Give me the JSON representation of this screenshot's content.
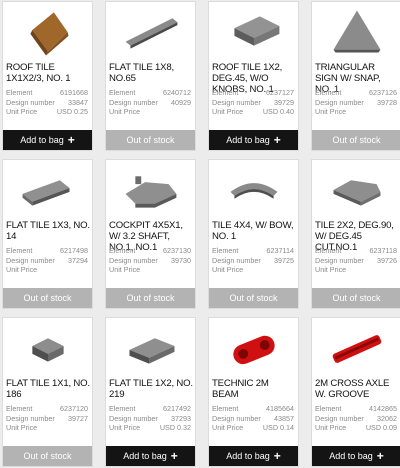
{
  "labels": {
    "element": "Element",
    "design_number": "Design number",
    "unit_price": "Unit Price",
    "add_to_bag": "Add to bag",
    "out_of_stock": "Out of stock",
    "plus": "+"
  },
  "products": [
    {
      "name": "ROOF TILE 1X1X2/3, NO. 1",
      "element": "6191668",
      "design": "33847",
      "price": "USD 0.25",
      "status": "add",
      "image": "roof-tile-brown-icon"
    },
    {
      "name": "FLAT TILE 1X8, NO.65",
      "element": "6240712",
      "design": "40929",
      "price": "",
      "status": "out",
      "image": "flat-tile-long-icon"
    },
    {
      "name": "ROOF TILE 1X2, DEG.45, W/O KNOBS, NO. 1",
      "element": "6237127",
      "design": "39729",
      "price": "USD 0.40",
      "status": "add",
      "image": "roof-tile-slope-icon"
    },
    {
      "name": "TRIANGULAR SIGN W/ SNAP, NO. 1",
      "element": "6237126",
      "design": "39728",
      "price": "",
      "status": "out",
      "image": "triangular-sign-icon"
    },
    {
      "name": "FLAT TILE 1X3, NO. 14",
      "element": "6217498",
      "design": "37294",
      "price": "",
      "status": "out",
      "image": "flat-tile-1x3-icon"
    },
    {
      "name": "COCKPIT 4X5X1, W/ 3.2 SHAFT, NO.1, NO.1",
      "element": "6237130",
      "design": "39730",
      "price": "",
      "status": "out",
      "image": "cockpit-icon"
    },
    {
      "name": "TILE 4X4, W/ BOW, NO. 1",
      "element": "6237114",
      "design": "39725",
      "price": "",
      "status": "out",
      "image": "tile-bow-icon"
    },
    {
      "name": "TILE 2X2, DEG.90, W/ DEG.45 CUT,NO.1",
      "element": "6237118",
      "design": "39726",
      "price": "",
      "status": "out",
      "image": "tile-corner-icon"
    },
    {
      "name": "FLAT TILE 1X1, NO. 186",
      "element": "6237120",
      "design": "39727",
      "price": "",
      "status": "out",
      "image": "flat-tile-1x1-icon"
    },
    {
      "name": "FLAT TILE 1X2, NO. 219",
      "element": "6217492",
      "design": "37293",
      "price": "USD 0.32",
      "status": "add",
      "image": "flat-tile-1x2-icon"
    },
    {
      "name": "TECHNIC 2M BEAM",
      "element": "4185664",
      "design": "43857",
      "price": "USD 0.14",
      "status": "add",
      "image": "technic-beam-icon"
    },
    {
      "name": "2M CROSS AXLE W. GROOVE",
      "element": "4142865",
      "design": "32062",
      "price": "USD 0.09",
      "status": "add",
      "image": "cross-axle-icon"
    }
  ],
  "colors": {
    "add_button": "#141414",
    "out_button": "#b3b3b3",
    "brick_grey": "#7d7d7d",
    "brick_brown": "#a0672b",
    "brick_red": "#d01010"
  }
}
